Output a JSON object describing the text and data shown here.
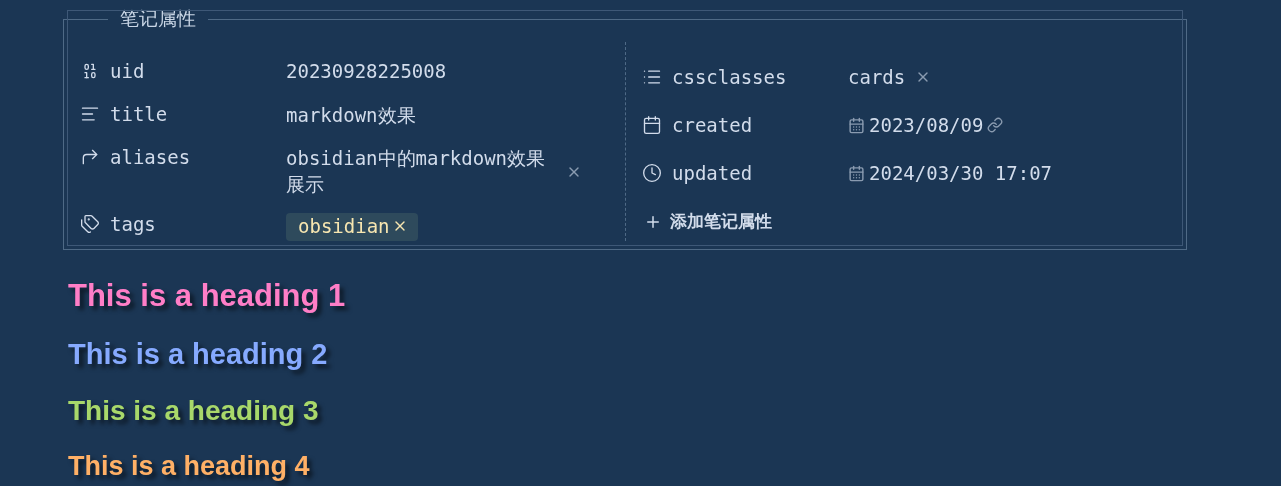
{
  "properties": {
    "title": "笔记属性",
    "left": [
      {
        "name": "uid",
        "kind": "text",
        "value": "20230928225008"
      },
      {
        "name": "title",
        "kind": "text",
        "value": "markdown效果"
      },
      {
        "name": "aliases",
        "kind": "list",
        "items": [
          "obsidian中的markdown效果展示"
        ]
      },
      {
        "name": "tags",
        "kind": "tags",
        "items": [
          "obsidian"
        ]
      }
    ],
    "right": [
      {
        "name": "cssclasses",
        "kind": "list",
        "items": [
          "cards"
        ]
      },
      {
        "name": "created",
        "kind": "linkdate",
        "value": "2023/08/09"
      },
      {
        "name": "updated",
        "kind": "date",
        "value": "2024/03/30 17:07"
      }
    ],
    "add_button": "添加笔记属性"
  },
  "headings": [
    {
      "text": "This is a heading 1",
      "color": "#ff7ec7"
    },
    {
      "text": "This is a heading 2",
      "color": "#86aaff"
    },
    {
      "text": "This is a heading 3",
      "color": "#a8d86a"
    },
    {
      "text": "This is a heading 4",
      "color": "#ffb066"
    }
  ]
}
